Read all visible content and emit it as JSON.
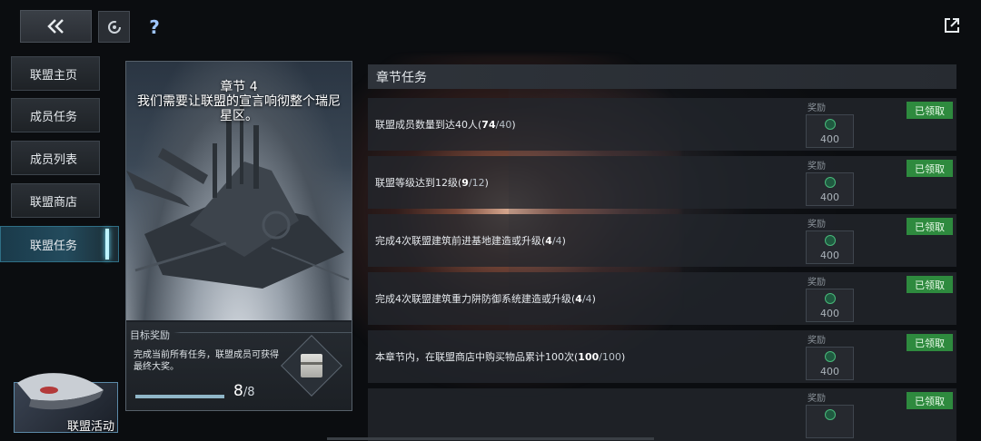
{
  "topbar": {
    "back_icon": "double-chevron-left-icon",
    "refresh_icon": "refresh-icon",
    "help_label": "?",
    "expand_icon": "external-link-icon"
  },
  "sidebar": {
    "items": [
      {
        "label": "联盟主页"
      },
      {
        "label": "成员任务"
      },
      {
        "label": "成员列表"
      },
      {
        "label": "联盟商店"
      },
      {
        "label": "联盟任务",
        "active": true
      }
    ]
  },
  "chapter": {
    "title": "章节 4",
    "subtitle": "我们需要让联盟的宣言响彻整个瑞尼星区。",
    "goal_label": "目标奖励",
    "goal_desc": "完成当前所有任务，联盟成员可获得最终大奖。",
    "progress_done": "8",
    "progress_total": "/8",
    "progress_fraction": 1.0
  },
  "tasks_panel": {
    "header": "章节任务",
    "reward_label": "奖励",
    "claimed_label": "已领取",
    "tasks": [
      {
        "text": "联盟成员数量到达40人(",
        "done": "74",
        "total": "/40",
        "close": ")",
        "reward": "400"
      },
      {
        "text": "联盟等级达到12级(",
        "done": "9",
        "total": "/12",
        "close": ")",
        "reward": "400"
      },
      {
        "text": "完成4次联盟建筑前进基地建造或升级(",
        "done": "4",
        "total": "/4",
        "close": ")",
        "reward": "400"
      },
      {
        "text": "完成4次联盟建筑重力阱防御系统建造或升级(",
        "done": "4",
        "total": "/4",
        "close": ")",
        "reward": "400"
      },
      {
        "text": "本章节内，在联盟商店中购买物品累计100次(",
        "done": "100",
        "total": "/100",
        "close": ")",
        "reward": "400"
      },
      {
        "text": "",
        "done": "",
        "total": "",
        "close": "",
        "reward": ""
      }
    ]
  },
  "activity": {
    "label": "联盟活动"
  },
  "colors": {
    "claimed": "#2e8a3e",
    "active_tab": "#234b5d",
    "reward_icon": "#48b97a"
  }
}
